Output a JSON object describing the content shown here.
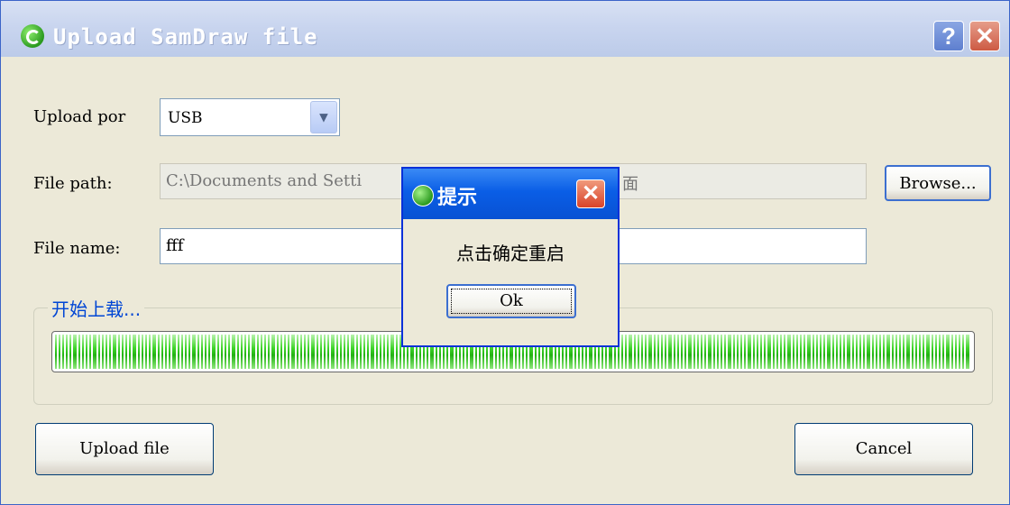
{
  "window": {
    "title": "Upload SamDraw file",
    "help_label": "?",
    "close_label": "✕",
    "icon": "refresh-icon"
  },
  "form": {
    "upload_port_label": "Upload por",
    "upload_port_value": "USB",
    "file_path_label": "File path:",
    "file_path_value": "C:\\Documents and Setti",
    "file_path_value_tail": "面",
    "browse_label": "Browse...",
    "file_name_label": "File name:",
    "file_name_value": "fff"
  },
  "progress": {
    "group_title": "开始上载...",
    "fraction": 1.0
  },
  "buttons": {
    "upload_label": "Upload file",
    "cancel_label": "Cancel"
  },
  "modal": {
    "title": "提示",
    "message": "点击确定重启",
    "ok_label": "Ok",
    "close_label": "✕"
  },
  "colors": {
    "progress_green": "#22b312",
    "title_blue": "#0851d3",
    "group_title": "#0046d5"
  }
}
